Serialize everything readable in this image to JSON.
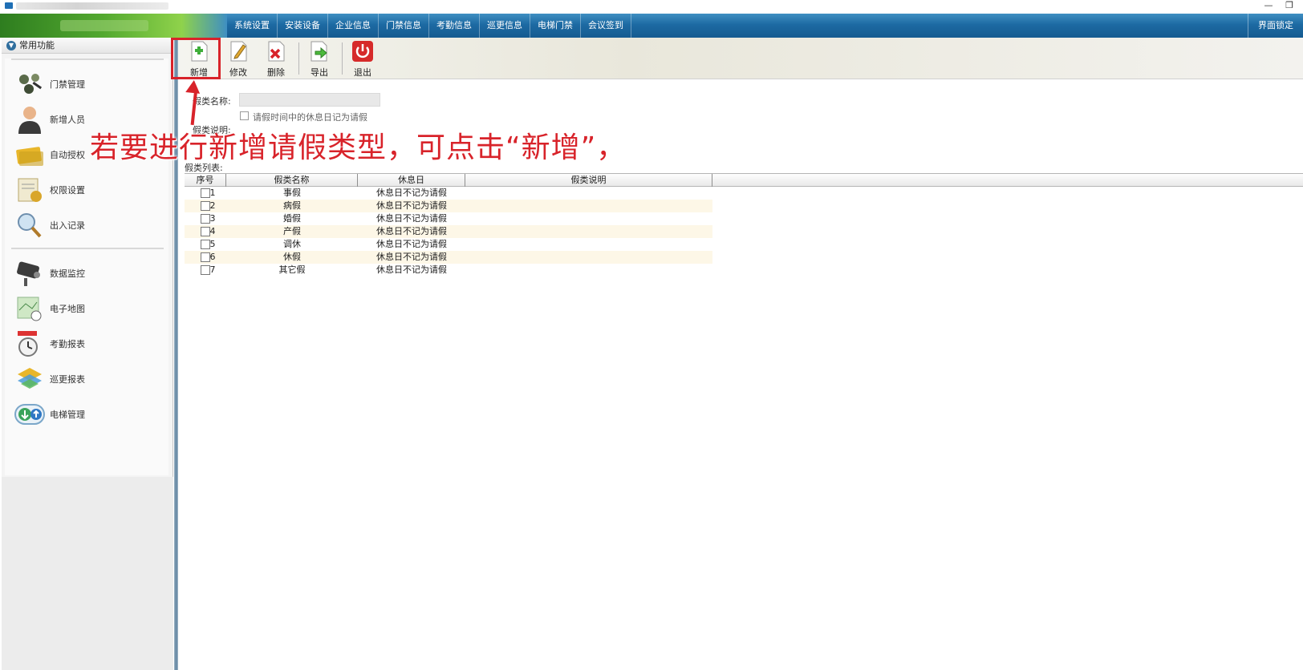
{
  "menu": {
    "items": [
      "系统设置",
      "安装设备",
      "企业信息",
      "门禁信息",
      "考勤信息",
      "巡更信息",
      "电梯门禁",
      "会议签到"
    ],
    "lock": "界面锁定"
  },
  "sidebar": {
    "header": "常用功能",
    "items": [
      {
        "label": "门禁管理",
        "icon": "door-access-icon"
      },
      {
        "label": "新增人员",
        "icon": "person-icon"
      },
      {
        "label": "自动授权",
        "icon": "card-icon"
      },
      {
        "label": "权限设置",
        "icon": "permission-icon"
      },
      {
        "label": "出入记录",
        "icon": "magnifier-icon"
      },
      {
        "label": "数据监控",
        "icon": "camera-icon"
      },
      {
        "label": "电子地图",
        "icon": "map-icon"
      },
      {
        "label": "考勤报表",
        "icon": "clock-icon"
      },
      {
        "label": "巡更报表",
        "icon": "layers-icon"
      },
      {
        "label": "电梯管理",
        "icon": "elevator-icon"
      }
    ]
  },
  "toolbar": {
    "add": "新增",
    "edit": "修改",
    "delete": "删除",
    "export": "导出",
    "exit": "退出"
  },
  "form": {
    "name_label": "假类名称:",
    "checkbox_label": "请假时间中的休息日记为请假",
    "desc_label": "假类说明:",
    "list_label": "假类列表:"
  },
  "annotation": "若要进行新增请假类型，可点击“新增”，",
  "table": {
    "headers": [
      "序号",
      "假类名称",
      "休息日",
      "假类说明"
    ],
    "rows": [
      {
        "no": "1",
        "name": "事假",
        "rest": "休息日不记为请假",
        "desc": ""
      },
      {
        "no": "2",
        "name": "病假",
        "rest": "休息日不记为请假",
        "desc": ""
      },
      {
        "no": "3",
        "name": "婚假",
        "rest": "休息日不记为请假",
        "desc": ""
      },
      {
        "no": "4",
        "name": "产假",
        "rest": "休息日不记为请假",
        "desc": ""
      },
      {
        "no": "5",
        "name": "调休",
        "rest": "休息日不记为请假",
        "desc": ""
      },
      {
        "no": "6",
        "name": "休假",
        "rest": "休息日不记为请假",
        "desc": ""
      },
      {
        "no": "7",
        "name": "其它假",
        "rest": "休息日不记为请假",
        "desc": ""
      }
    ]
  },
  "colors": {
    "accent_red": "#d8232a",
    "menu_blue": "#1d6aa3",
    "brand_green": "#52a82f",
    "row_alt": "#fdf7e7"
  }
}
